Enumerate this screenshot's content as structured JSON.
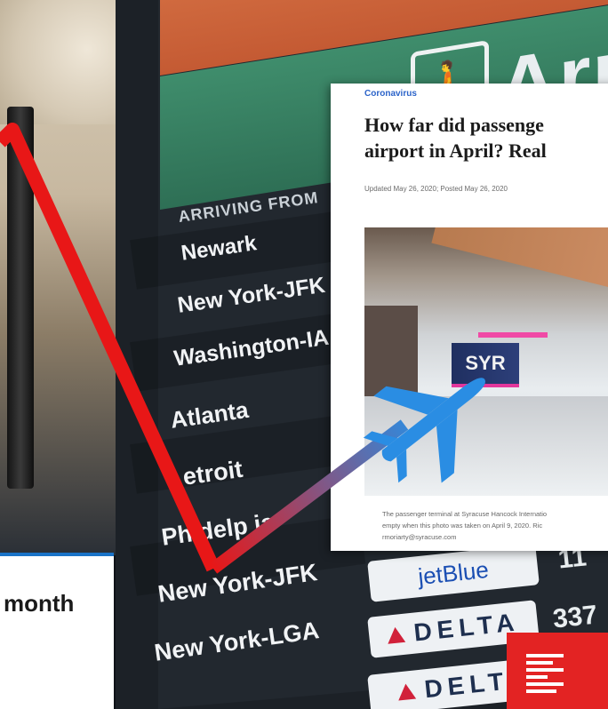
{
  "board": {
    "arr_text": "Arr",
    "arriving_header": "ARRIVING FROM",
    "cities": [
      "Newark",
      "New York-JFK",
      "Washington-IA",
      "Atlanta",
      "etroit",
      "Ph  delp  ia",
      "New York-JFK",
      "New York-LGA"
    ],
    "airlines": {
      "jetblue": "jetBlue",
      "delta1": "DELTA",
      "delta2": "DELT"
    },
    "flight_numbers": [
      "11",
      "337"
    ]
  },
  "article": {
    "category": "Coronavirus",
    "headline_line1": "How far did passenge",
    "headline_line2": "airport in April? Real",
    "dateline": "Updated May 26, 2020; Posted May 26, 2020",
    "photo_sign": "SYR",
    "caption_line1": "The passenger terminal at Syracuse Hancock Internatio",
    "caption_line2": "empty when this photo was taken on April 9, 2020.  Ric",
    "caption_line3": "rmoriarty@syracuse.com"
  },
  "overlay": {
    "caption_text": "month",
    "line_color": "#e81717",
    "plane_color": "#2a8de3"
  }
}
